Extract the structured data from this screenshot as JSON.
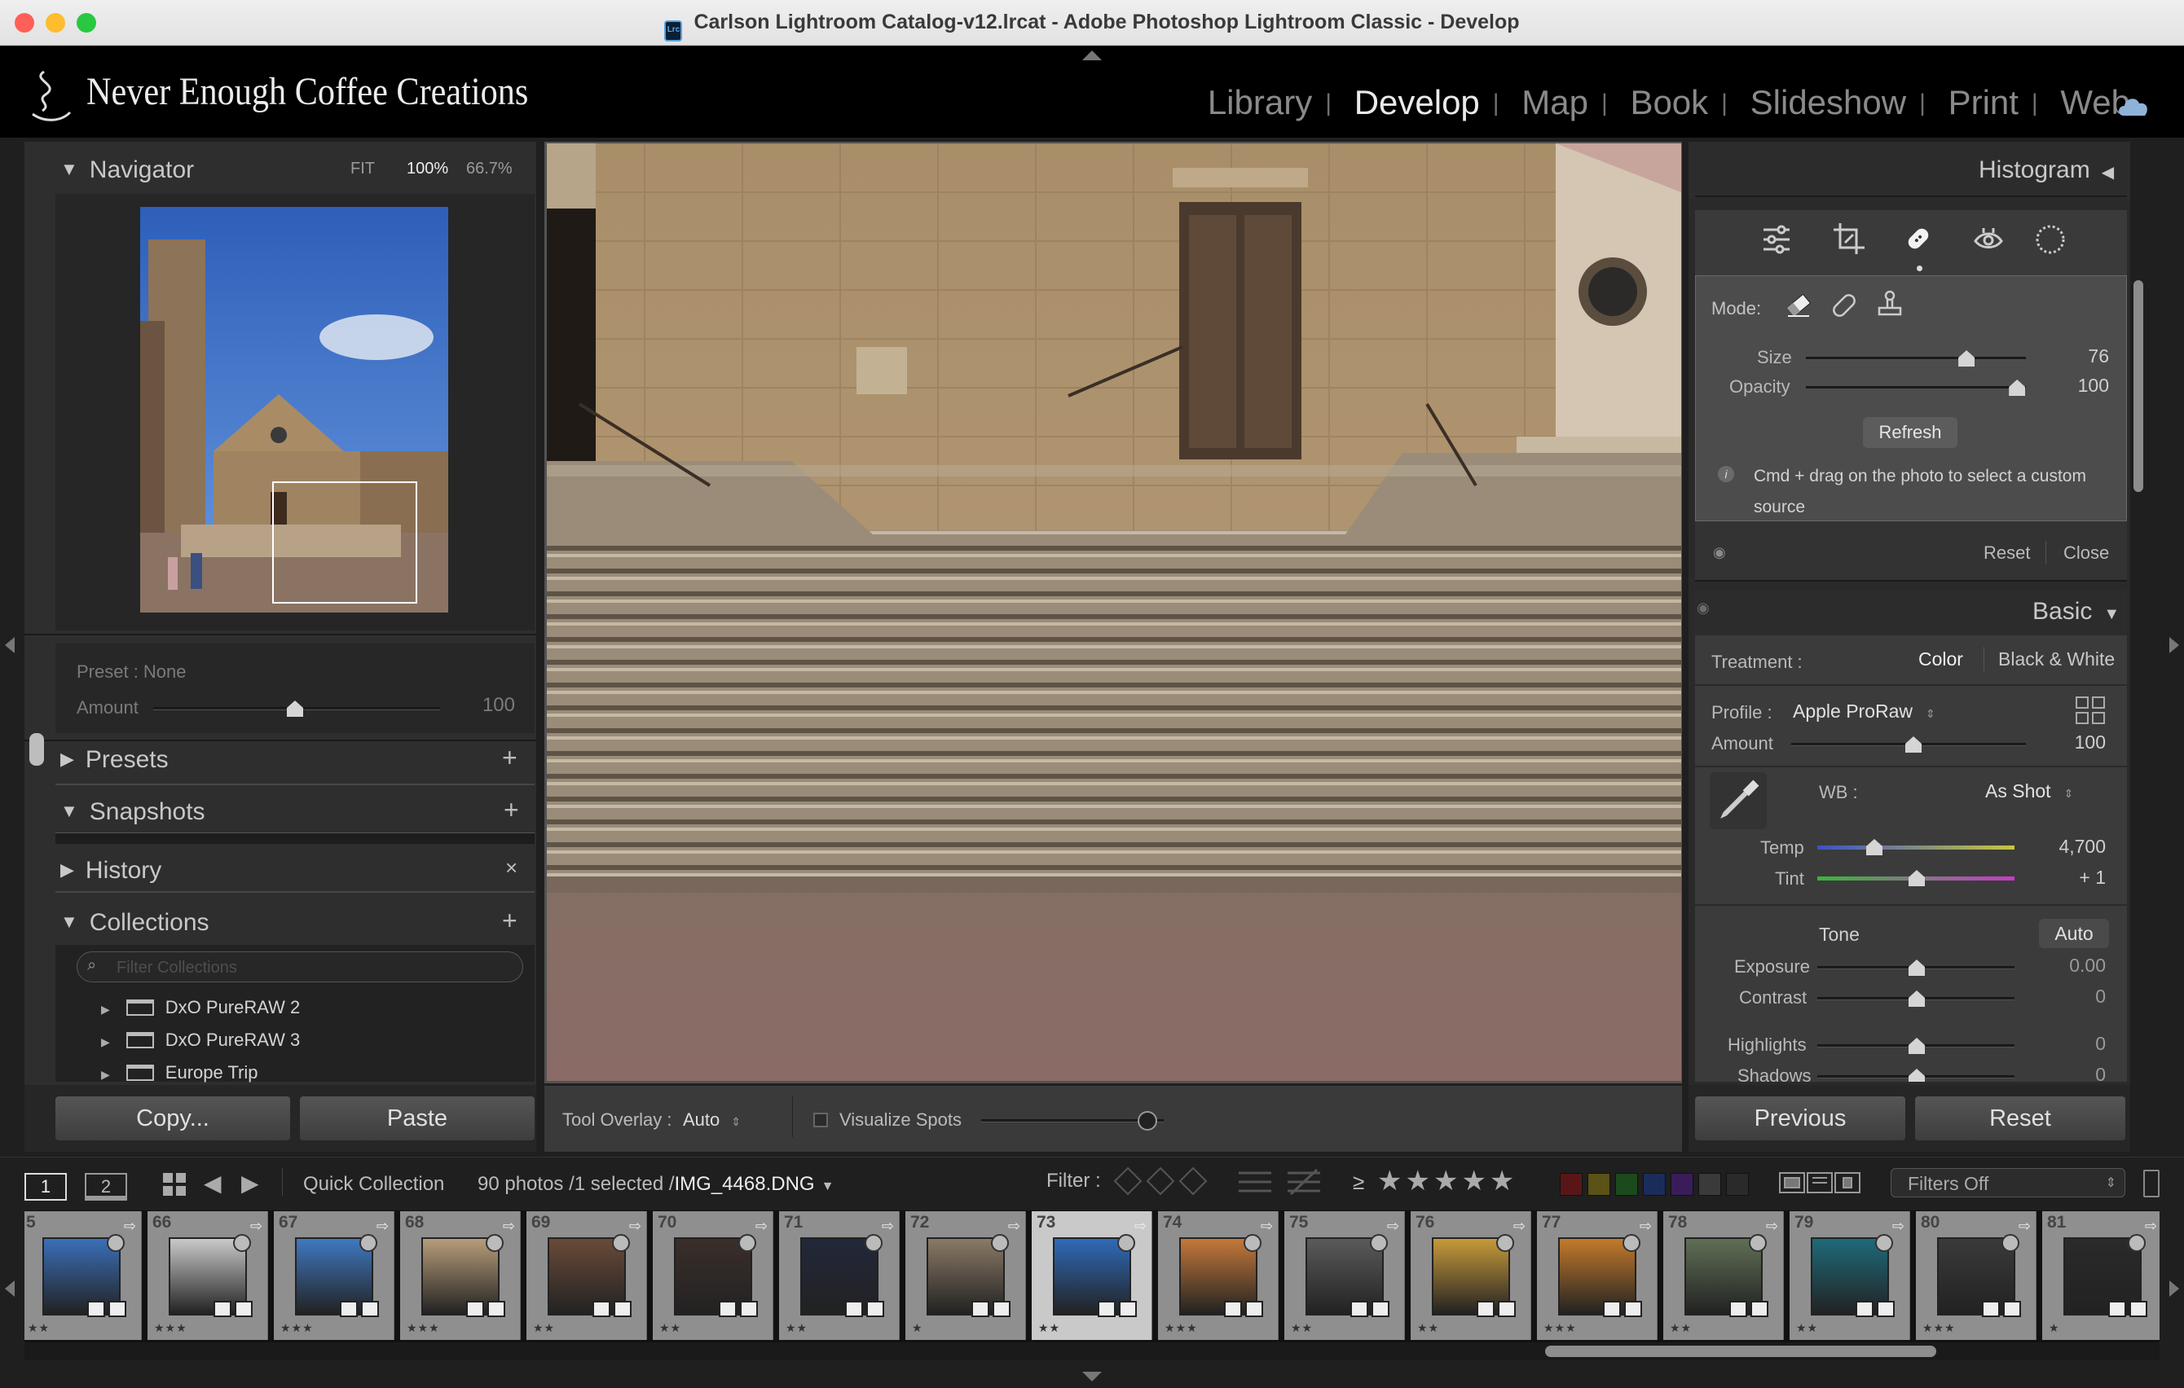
{
  "window": {
    "title": "Carlson Lightroom Catalog-v12.lrcat - Adobe Photoshop Lightroom Classic - Develop",
    "app_icon": "Lrc"
  },
  "identity_plate": "Never Enough Coffee Creations",
  "modules": [
    {
      "label": "Library",
      "active": false
    },
    {
      "label": "Develop",
      "active": true
    },
    {
      "label": "Map",
      "active": false
    },
    {
      "label": "Book",
      "active": false
    },
    {
      "label": "Slideshow",
      "active": false
    },
    {
      "label": "Print",
      "active": false
    },
    {
      "label": "Web",
      "active": false
    }
  ],
  "left": {
    "navigator": {
      "title": "Navigator",
      "zoom_options": [
        "FIT",
        "100%",
        "66.7%"
      ],
      "active_zoom": "100%"
    },
    "preset": {
      "label": "Preset : None",
      "amount_label": "Amount",
      "amount_value": "100"
    },
    "presets": {
      "title": "Presets"
    },
    "snapshots": {
      "title": "Snapshots"
    },
    "history": {
      "title": "History"
    },
    "collections": {
      "title": "Collections",
      "filter_placeholder": "Filter Collections",
      "items": [
        "DxO PureRAW 2",
        "DxO PureRAW 3",
        "Europe Trip"
      ]
    },
    "copy_button": "Copy...",
    "paste_button": "Paste"
  },
  "toolbar": {
    "tool_overlay_label": "Tool Overlay :",
    "tool_overlay_value": "Auto",
    "visualize_spots": "Visualize Spots"
  },
  "right": {
    "histogram_title": "Histogram",
    "healing": {
      "mode_label": "Mode:",
      "size_label": "Size",
      "size_value": "76",
      "size_fraction": 0.73,
      "opacity_label": "Opacity",
      "opacity_value": "100",
      "opacity_fraction": 0.96,
      "refresh_button": "Refresh",
      "hint": "Cmd + drag on the photo to select a custom source",
      "reset": "Reset",
      "close": "Close"
    },
    "basic": {
      "title": "Basic",
      "treatment_label": "Treatment :",
      "treatment_color": "Color",
      "treatment_bw": "Black & White",
      "profile_label": "Profile :",
      "profile_value": "Apple ProRaw",
      "amount_label": "Amount",
      "amount_value": "100",
      "wb_label": "WB :",
      "wb_value": "As Shot",
      "temp_label": "Temp",
      "temp_value": "4,700",
      "tint_label": "Tint",
      "tint_value": "+ 1",
      "tone_label": "Tone",
      "auto_button": "Auto",
      "exposure_label": "Exposure",
      "exposure_value": "0.00",
      "contrast_label": "Contrast",
      "contrast_value": "0",
      "highlights_label": "Highlights",
      "highlights_value": "0",
      "shadows_label": "Shadows",
      "shadows_value": "0"
    },
    "previous_button": "Previous",
    "reset_button": "Reset"
  },
  "filmstrip_bar": {
    "page1": "1",
    "page2": "2",
    "source": "Quick Collection",
    "count": "90 photos /1 selected /",
    "filename": "IMG_4468.DNG",
    "filter_label": "Filter :",
    "rating_op": "≥",
    "filters_off": "Filters Off"
  },
  "filmstrip": [
    {
      "num": "5",
      "stars": "★★",
      "thumb": "#3a6fb8"
    },
    {
      "num": "66",
      "stars": "★★★",
      "thumb": "#c9c9c9"
    },
    {
      "num": "67",
      "stars": "★★★",
      "thumb": "#3f78c0"
    },
    {
      "num": "68",
      "stars": "★★★",
      "thumb": "#b79d7a"
    },
    {
      "num": "69",
      "stars": "★★",
      "thumb": "#6a4a38"
    },
    {
      "num": "70",
      "stars": "★★",
      "thumb": "#3a2e2a"
    },
    {
      "num": "71",
      "stars": "★★",
      "thumb": "#22283a"
    },
    {
      "num": "72",
      "stars": "★",
      "thumb": "#8a7a66"
    },
    {
      "num": "73",
      "stars": "★★",
      "thumb": "#2f6ab8"
    },
    {
      "num": "74",
      "stars": "★★★",
      "thumb": "#c4783a"
    },
    {
      "num": "75",
      "stars": "★★",
      "thumb": "#5a5a5a"
    },
    {
      "num": "76",
      "stars": "★★",
      "thumb": "#c79a3a"
    },
    {
      "num": "77",
      "stars": "★★★",
      "thumb": "#c37a2a"
    },
    {
      "num": "78",
      "stars": "★★",
      "thumb": "#5f6f55"
    },
    {
      "num": "79",
      "stars": "★★",
      "thumb": "#1f6a7a"
    },
    {
      "num": "80",
      "stars": "★★★",
      "thumb": "#3a3a3a"
    },
    {
      "num": "81",
      "stars": "★",
      "thumb": "#2a2a2a"
    }
  ],
  "colors": {
    "accent": "#e6e6e6",
    "panel": "#2e2e2e",
    "background": "#1f1f1f",
    "filmstrip_bg": "#8f8f8f"
  }
}
